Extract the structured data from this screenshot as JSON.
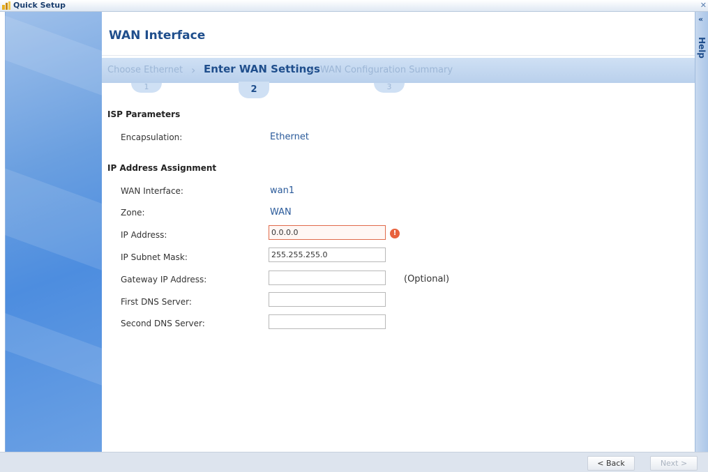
{
  "window": {
    "title": "Quick Setup"
  },
  "page": {
    "title": "WAN Interface"
  },
  "steps": [
    {
      "label": "Choose Ethernet",
      "number": "1",
      "state": "inactive"
    },
    {
      "label": "Enter WAN Settings",
      "number": "2",
      "state": "active"
    },
    {
      "label": "WAN Configuration Summary",
      "number": "3",
      "state": "inactive"
    }
  ],
  "isp": {
    "heading": "ISP Parameters",
    "encapsulation_label": "Encapsulation:",
    "encapsulation_value": "Ethernet"
  },
  "ip": {
    "heading": "IP Address Assignment",
    "wan_interface_label": "WAN Interface:",
    "wan_interface_value": "wan1",
    "zone_label": "Zone:",
    "zone_value": "WAN",
    "ip_address_label": "IP Address:",
    "ip_address_value": "0.0.0.0",
    "subnet_label": "IP Subnet Mask:",
    "subnet_value": "255.255.255.0",
    "gateway_label": "Gateway IP Address:",
    "gateway_value": "",
    "gateway_hint": "(Optional)",
    "dns1_label": "First DNS Server:",
    "dns1_value": "",
    "dns2_label": "Second DNS Server:",
    "dns2_value": ""
  },
  "help": {
    "label": "Help",
    "collapse_glyph": "«"
  },
  "footer": {
    "back_label": "< Back",
    "next_label": "Next >"
  },
  "colors": {
    "accent": "#1f4e8c",
    "error": "#e8613c",
    "step_bar": "#cfe0f4"
  }
}
